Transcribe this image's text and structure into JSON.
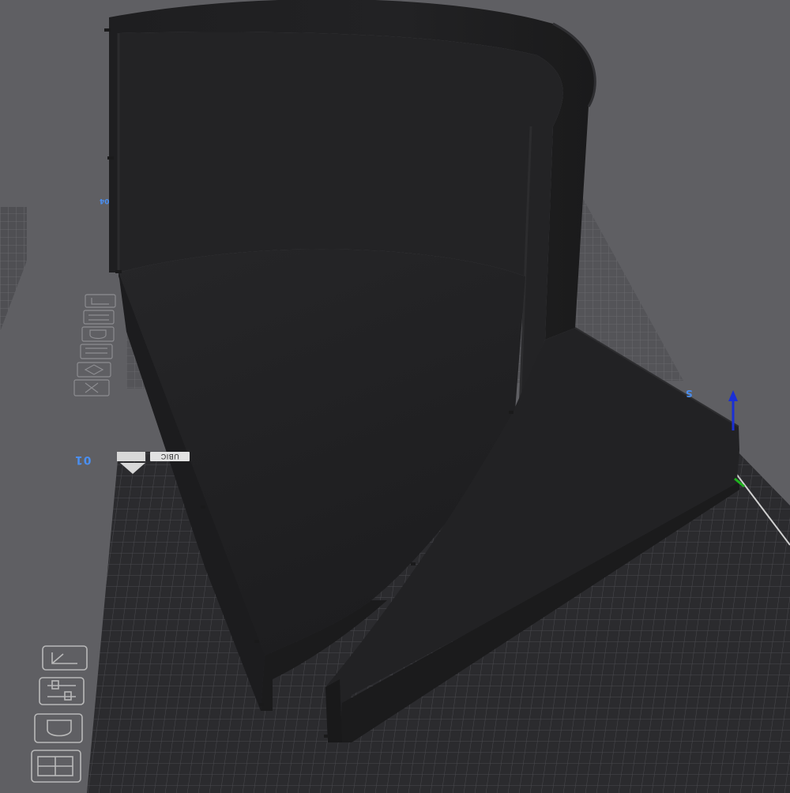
{
  "viewport": {
    "background": "#5f5f63",
    "plate_front_color": "#2b2b2e",
    "plate_back_color": "#4d4d51",
    "model_color": "#1f1f21",
    "axis_colors": {
      "z": "#1a2fd6",
      "y": "#1fb31f"
    }
  },
  "plate": {
    "front_label": "01",
    "back_label": "04",
    "side_label": "S",
    "brand_tag": "UBIC"
  },
  "toolbar_front": {
    "icons": [
      "arrange-icon",
      "adjust-sliders-icon",
      "support-icon",
      "layout-icon"
    ]
  },
  "toolbar_back": {
    "icons": [
      "arrange-icon",
      "adjust-sliders-icon",
      "support-icon",
      "layout-icon",
      "orient-icon",
      "close-icon"
    ]
  }
}
